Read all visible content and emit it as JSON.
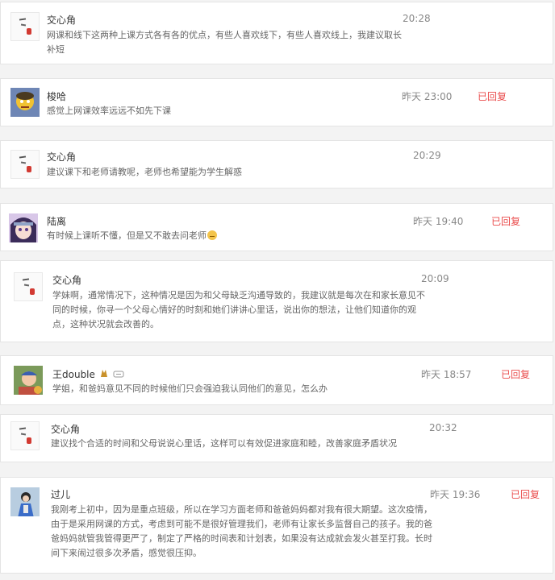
{
  "comments": [
    {
      "name": "交心角",
      "time": "20:28",
      "text": "网课和线下这两种上课方式各有各的优点，有些人喜欢线下，有些人喜欢线上，我建议取长补短",
      "replied": ""
    },
    {
      "name": "梭哈",
      "time": "昨天 23:00",
      "text": "感觉上网课效率远远不如先下课",
      "replied": "已回复"
    },
    {
      "name": "交心角",
      "time": "20:29",
      "text": "建议课下和老师请教呢，老师也希望能为学生解惑",
      "replied": ""
    },
    {
      "name": "陆离",
      "time": "昨天 19:40",
      "text": "有时候上课听不懂，但是又不敢去问老师",
      "replied": "已回复"
    },
    {
      "name": "交心角",
      "time": "20:09",
      "text": "学妹啊，通常情况下，这种情况是因为和父母缺乏沟通导致的，我建议就是每次在和家长意见不同的时候，你寻一个父母心情好的时刻和她们讲讲心里话，说出你的想法，让他们知道你的观点，这种状况就会改善的。",
      "replied": ""
    },
    {
      "name": "王double",
      "time": "昨天 18:57",
      "text": "学姐，和爸妈意见不同的时候他们只会强迫我认同他们的意见，怎么办",
      "replied": "已回复"
    },
    {
      "name": "交心角",
      "time": "20:32",
      "text": "建议找个合适的时间和父母说说心里话，这样可以有效促进家庭和睦，改善家庭矛盾状况",
      "replied": ""
    },
    {
      "name": "过儿",
      "time": "昨天 19:36",
      "text": "我刚考上初中，因为是重点班级，所以在学习方面老师和爸爸妈妈都对我有很大期望。这次疫情，由于是采用网课的方式，考虑到可能不是很好管理我们，老师有让家长多监督自己的孩子。我的爸爸妈妈就管我管得更严了，制定了严格的时间表和计划表，如果没有达成就会发火甚至打我。长时间下来闹过很多次矛盾，感觉很压抑。",
      "replied": "已回复"
    }
  ]
}
